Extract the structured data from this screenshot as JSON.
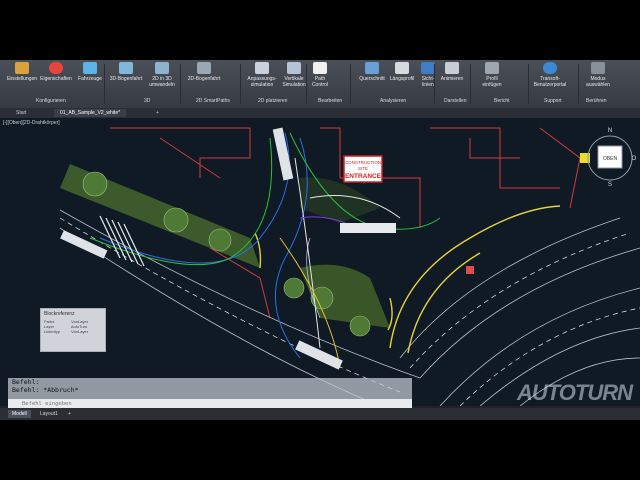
{
  "ribbon": {
    "buttons": [
      {
        "label": "Einstellungen"
      },
      {
        "label": "Eigenschaften"
      },
      {
        "label": "Fahrzeuge"
      },
      {
        "label": "3D-Bogenfahrt"
      },
      {
        "label": "2D in 3D\numwandeln"
      },
      {
        "label": "2D-Bogenfahrt"
      },
      {
        "label": "Anpassungs-\nsimulation"
      },
      {
        "label": "Vertikale\nSimulation"
      },
      {
        "label": "Path\nControl"
      },
      {
        "label": "Querschnitt"
      },
      {
        "label": "Längsprofil"
      },
      {
        "label": "Sicht-\nlinien"
      },
      {
        "label": "Animieren"
      },
      {
        "label": "Profil\neinfügen"
      },
      {
        "label": "Transoft-\nBenutzerportal"
      },
      {
        "label": "Modus\nauswählen"
      }
    ],
    "groups": [
      {
        "label": "Konfigurieren"
      },
      {
        "label": "3D"
      },
      {
        "label": "2D SmartPaths"
      },
      {
        "label": "2D platzieren"
      },
      {
        "label": "Bearbeiten"
      },
      {
        "label": "Analysieren"
      },
      {
        "label": "Darstellen"
      },
      {
        "label": "Bericht"
      },
      {
        "label": "Support"
      },
      {
        "label": "Berühren"
      }
    ]
  },
  "tabs": {
    "start": "Start",
    "file": "01_AB_Sample_V2_white*",
    "plus": "+"
  },
  "view": {
    "label": "[-][Oben][2D-Drahtkörper]",
    "sign_construction": "CONSTRUCTION",
    "sign_site": "SITE",
    "sign_entrance": "ENTRANCE",
    "compass_n": "N",
    "compass_s": "S",
    "compass_o": "O",
    "viewcube": "OBEN"
  },
  "tooltip": {
    "title": "Blockreferenz",
    "rows": [
      {
        "k": "Farbe",
        "v": "VonLayer"
      },
      {
        "k": "Layer",
        "v": "AutoTurn"
      },
      {
        "k": "Linientyp",
        "v": "VonLayer"
      }
    ]
  },
  "command": {
    "lines": [
      "Befehl:",
      "Befehl: *Abbruch*"
    ],
    "placeholder": "Befehl eingeben"
  },
  "status": {
    "model": "Modell",
    "layout": "Layout1",
    "plus": "+"
  },
  "watermark": {
    "text": "AUTOTURN"
  }
}
